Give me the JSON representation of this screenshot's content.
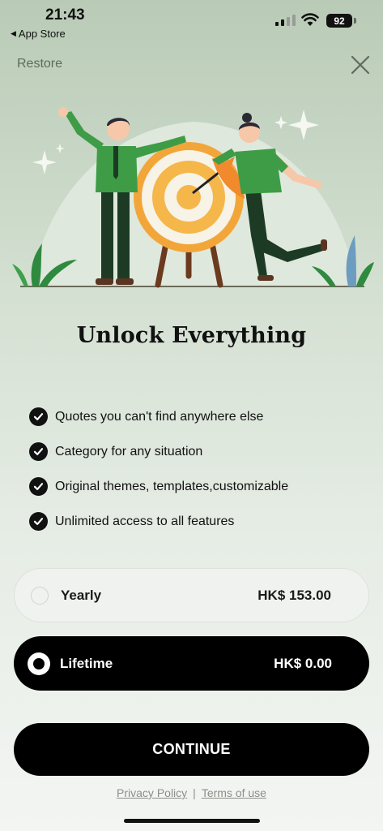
{
  "status_bar": {
    "time": "21:43",
    "back_label": "App Store",
    "battery": "92"
  },
  "header": {
    "restore_label": "Restore",
    "close_icon": "close-icon"
  },
  "title": "Unlock Everything",
  "features": [
    "Quotes you can't find anywhere else",
    "Category for any situation",
    "Original themes, templates,customizable",
    "Unlimited access to all features"
  ],
  "plans": [
    {
      "name": "Yearly",
      "price": "HK$ 153.00",
      "selected": false
    },
    {
      "name": "Lifetime",
      "price": "HK$ 0.00",
      "selected": true
    }
  ],
  "continue_label": "CONTINUE",
  "footer": {
    "privacy_label": "Privacy Policy",
    "separator": "|",
    "terms_label": "Terms of use"
  },
  "colors": {
    "accent_green": "#3e9c47",
    "dark_green": "#1f4a2a",
    "target_orange": "#f2a63a",
    "primary_black": "#000000"
  }
}
